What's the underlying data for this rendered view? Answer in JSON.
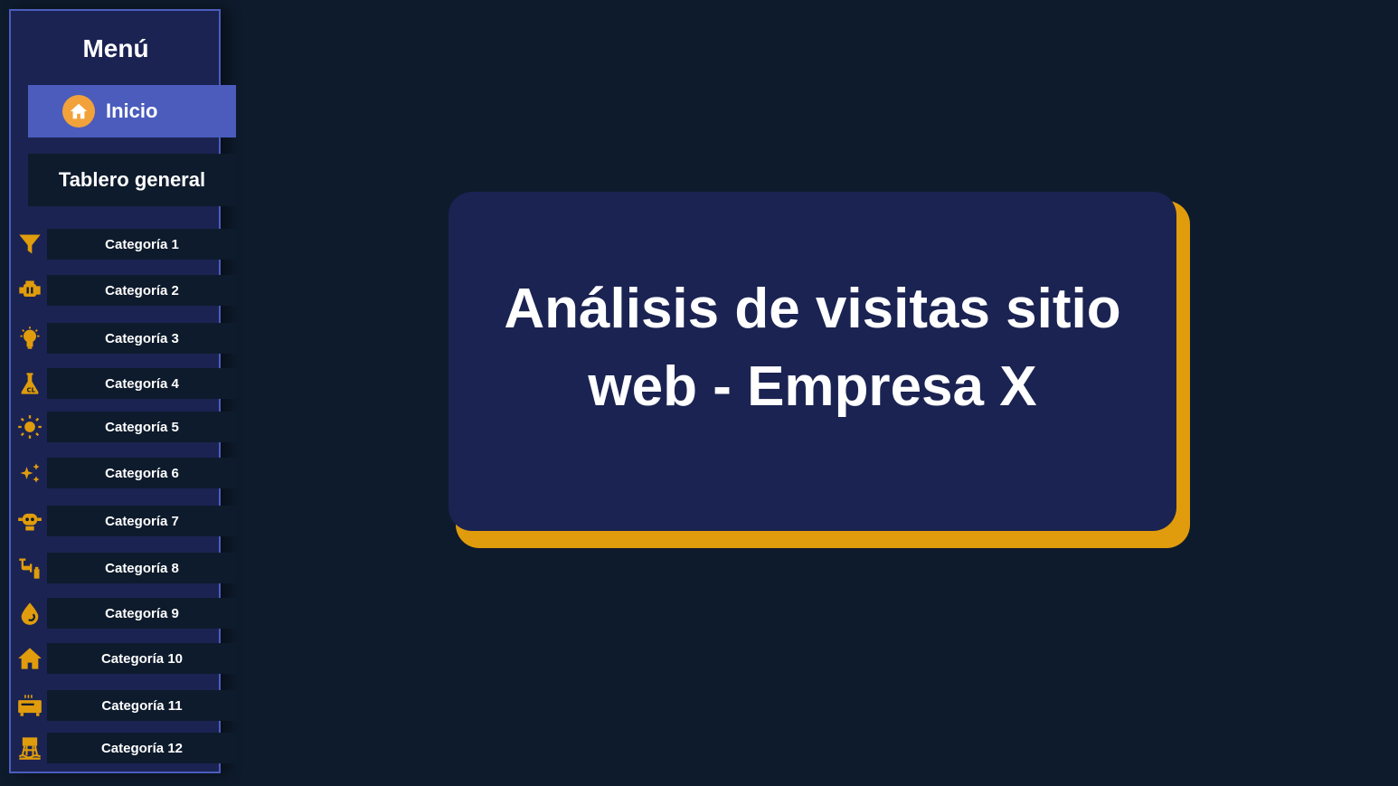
{
  "sidebar": {
    "title": "Menú",
    "home": {
      "label": "Inicio",
      "icon": "home-icon"
    },
    "overview": {
      "label": "Tablero general"
    },
    "categories": [
      {
        "label": "Categoría 1",
        "icon": "filter-icon"
      },
      {
        "label": "Categoría 2",
        "icon": "engine-icon"
      },
      {
        "label": "Categoría 3",
        "icon": "lightbulb-icon"
      },
      {
        "label": "Categoría 4",
        "icon": "flask-icon"
      },
      {
        "label": "Categoría 5",
        "icon": "sun-icon"
      },
      {
        "label": "Categoría 6",
        "icon": "sparkles-icon"
      },
      {
        "label": "Categoría 7",
        "icon": "robot-icon"
      },
      {
        "label": "Categoría 8",
        "icon": "pipe-icon"
      },
      {
        "label": "Categoría 9",
        "icon": "drop-icon"
      },
      {
        "label": "Categoría 10",
        "icon": "house-icon"
      },
      {
        "label": "Categoría 11",
        "icon": "heater-icon"
      },
      {
        "label": "Categoría 12",
        "icon": "water-tower-icon"
      }
    ]
  },
  "main": {
    "title": "Análisis de visitas sitio web - Empresa X"
  },
  "colors": {
    "background": "#0e1b2c",
    "panel": "#1b2352",
    "accent_blue": "#4b5cbd",
    "accent_gold": "#e09c0c",
    "icon_orange": "#f2a23a"
  }
}
